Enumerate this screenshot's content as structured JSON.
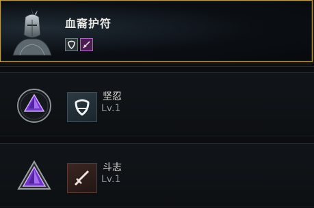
{
  "item": {
    "name": "血裔护符",
    "portrait_icon": "knight-helmet-portrait-icon",
    "traits": [
      {
        "icon": "tenacity-shield-icon",
        "color": "#6e7c84"
      },
      {
        "icon": "will-sword-icon",
        "color": "#b360c7"
      }
    ]
  },
  "skills": [
    {
      "name": "坚忍",
      "level": "Lv.1",
      "icon": "tenacity-shield-icon",
      "gem": "purple-circle-gem-icon"
    },
    {
      "name": "斗志",
      "level": "Lv.1",
      "icon": "will-sword-icon",
      "gem": "purple-triangle-gem-icon"
    }
  ],
  "colors": {
    "accent_gold": "#b99a55",
    "gem_purple": "#8a4bd6",
    "background": "#0b0d10"
  }
}
